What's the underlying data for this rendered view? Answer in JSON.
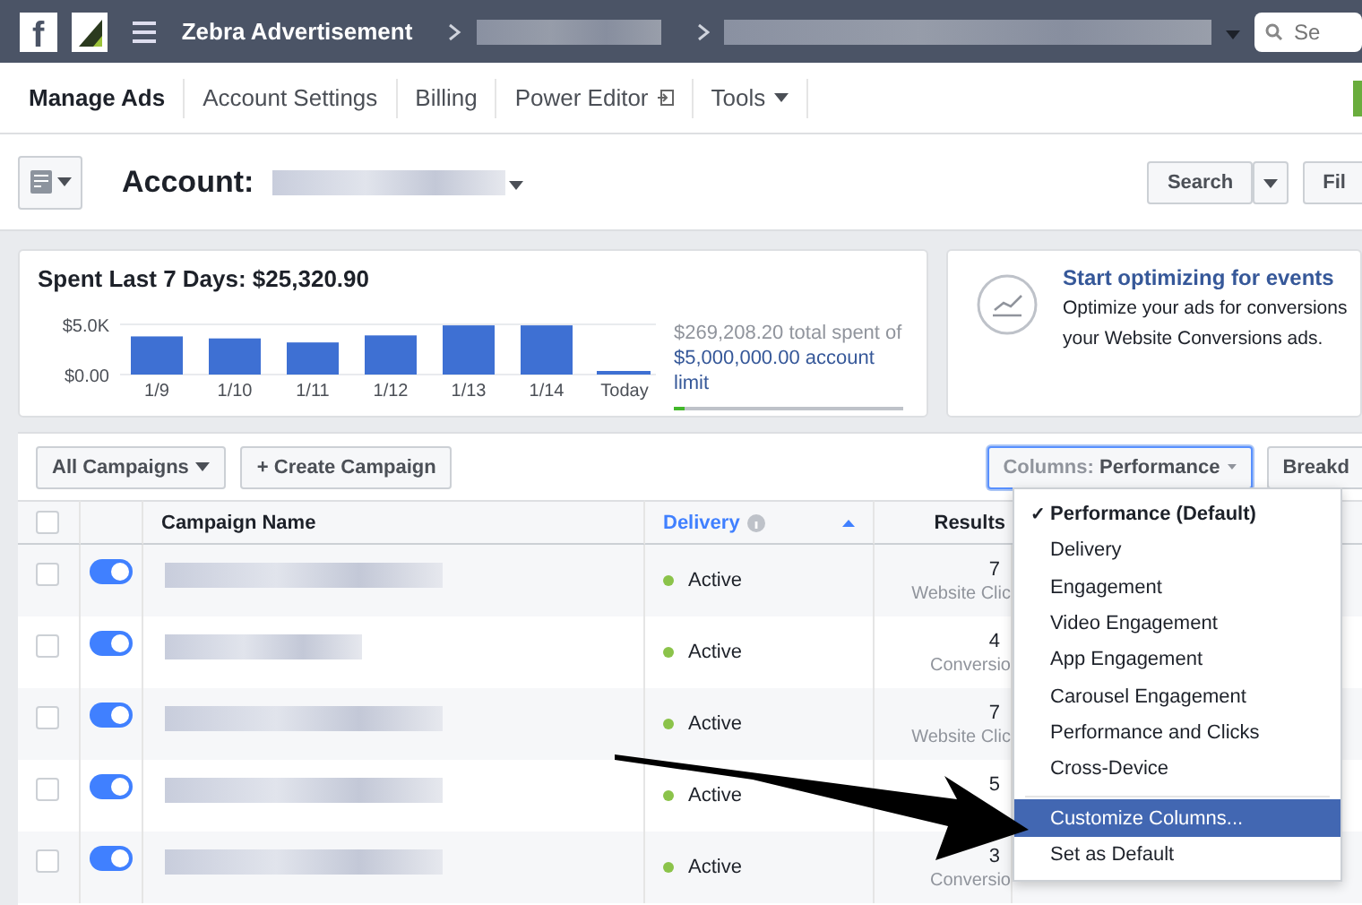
{
  "topbar": {
    "logo": "f",
    "page_name": "Zebra Advertisement",
    "search": {
      "placeholder": "Se"
    }
  },
  "nav": {
    "tabs": [
      {
        "label": "Manage Ads",
        "selected": true,
        "kind": "plain"
      },
      {
        "label": "Account Settings",
        "selected": false,
        "kind": "plain"
      },
      {
        "label": "Billing",
        "selected": false,
        "kind": "plain"
      },
      {
        "label": "Power Editor",
        "selected": false,
        "kind": "external"
      },
      {
        "label": "Tools",
        "selected": false,
        "kind": "dropdown"
      }
    ]
  },
  "account": {
    "label": "Account:",
    "buttons": [
      {
        "label": "Search",
        "kind": "split"
      },
      {
        "label": "Fil",
        "kind": "plain"
      }
    ]
  },
  "spend": {
    "title": "Spent Last 7 Days: $25,320.90",
    "total": "$269,208.20 total spent of",
    "limit": "$5,000,000.00 account limit",
    "level": 0.05,
    "chart_data": {
      "type": "bar",
      "categories": [
        "1/9",
        "1/10",
        "1/11",
        "1/12",
        "1/13",
        "1/14",
        "Today"
      ],
      "values": [
        3800,
        3600,
        3200,
        3900,
        4900,
        4900,
        200
      ],
      "ylim": [
        0,
        5000
      ],
      "yticks": [
        {
          "value": 0,
          "label": "$0.00"
        },
        {
          "value": 5000,
          "label": "$5.0K"
        }
      ]
    }
  },
  "promo": {
    "title": "Start optimizing for events",
    "lines": [
      "Optimize your ads for conversions",
      "your Website Conversions ads."
    ]
  },
  "toolbar": {
    "filter": "All Campaigns",
    "create": "+ Create Campaign",
    "columns_label": "Columns:",
    "columns_value": "Performance",
    "breakdown": "Breakd"
  },
  "table": {
    "select_all": {
      "checked": false
    },
    "columns": [
      {
        "label": "Campaign Name",
        "sorted": false
      },
      {
        "label": "Delivery",
        "sorted": true
      },
      {
        "label": "Results",
        "sorted": false
      }
    ],
    "rows": [
      {
        "checked": false,
        "on": true,
        "delivery": "Active",
        "color": "#8bc34a",
        "result": "7",
        "result_type": "Website Clic"
      },
      {
        "checked": false,
        "on": true,
        "delivery": "Active",
        "color": "#8bc34a",
        "result": "4",
        "result_type": "Conversio"
      },
      {
        "checked": false,
        "on": true,
        "delivery": "Active",
        "color": "#8bc34a",
        "result": "7",
        "result_type": "Website Clic"
      },
      {
        "checked": false,
        "on": true,
        "delivery": "Active",
        "color": "#8bc34a",
        "result": "5"
      },
      {
        "checked": false,
        "on": true,
        "delivery": "Active",
        "color": "#8bc34a",
        "result": "3",
        "result_type": "Conversio"
      }
    ]
  },
  "menu": {
    "items": [
      {
        "label": "Performance (Default)",
        "checked": true,
        "selected": false,
        "check": "✓"
      },
      {
        "label": "Delivery",
        "checked": false,
        "selected": false
      },
      {
        "label": "Engagement",
        "checked": false,
        "selected": false
      },
      {
        "label": "Video Engagement",
        "checked": false,
        "selected": false
      },
      {
        "label": "App Engagement",
        "checked": false,
        "selected": false
      },
      {
        "label": "Carousel Engagement",
        "checked": false,
        "selected": false
      },
      {
        "label": "Performance and Clicks",
        "checked": false,
        "selected": false
      },
      {
        "label": "Cross-Device",
        "checked": false,
        "selected": false
      },
      {
        "label": "Customize Columns...",
        "checked": false,
        "selected": true,
        "kind": "separated"
      },
      {
        "label": "Set as Default",
        "checked": false,
        "selected": false
      }
    ]
  }
}
